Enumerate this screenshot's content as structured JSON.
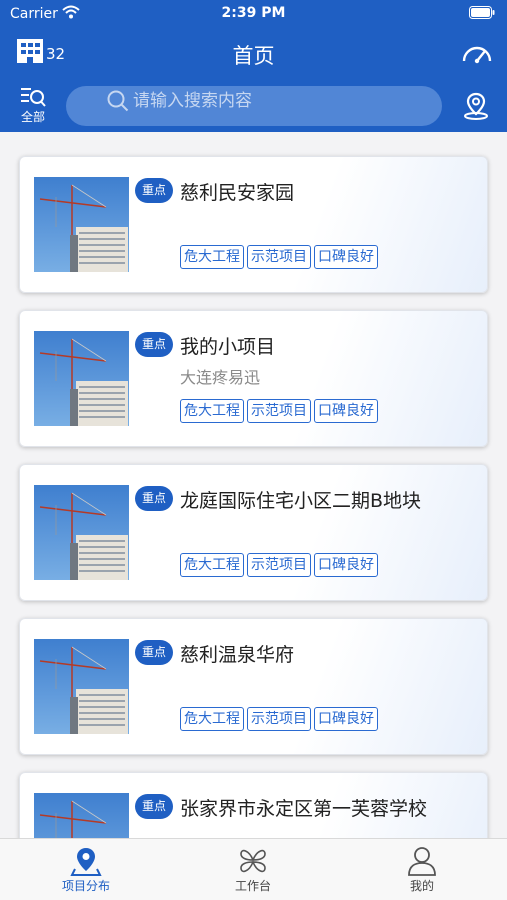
{
  "status_bar": {
    "carrier": "Carrier",
    "time": "2:39 PM"
  },
  "nav": {
    "title": "首页",
    "building_count": "32"
  },
  "search": {
    "filter_label": "全部",
    "placeholder": "请输入搜索内容"
  },
  "projects": [
    {
      "badge": "重点",
      "title": "慈利民安家园",
      "subtitle": "",
      "tags": [
        "危大工程",
        "示范项目",
        "口碑良好"
      ]
    },
    {
      "badge": "重点",
      "title": "我的小项目",
      "subtitle": "大连疼易迅",
      "tags": [
        "危大工程",
        "示范项目",
        "口碑良好"
      ]
    },
    {
      "badge": "重点",
      "title": "龙庭国际住宅小区二期B地块",
      "subtitle": "",
      "tags": [
        "危大工程",
        "示范项目",
        "口碑良好"
      ]
    },
    {
      "badge": "重点",
      "title": "慈利温泉华府",
      "subtitle": "",
      "tags": [
        "危大工程",
        "示范项目",
        "口碑良好"
      ]
    },
    {
      "badge": "重点",
      "title": "张家界市永定区第一芙蓉学校",
      "subtitle": "",
      "tags": []
    }
  ],
  "tabbar": [
    {
      "label": "项目分布",
      "icon": "location-pin-icon",
      "active": true
    },
    {
      "label": "工作台",
      "icon": "workbench-icon",
      "active": false
    },
    {
      "label": "我的",
      "icon": "person-icon",
      "active": false
    }
  ],
  "colors": {
    "primary": "#1f5fc3",
    "tag": "#2a6ad1",
    "background": "#f3f3f5"
  }
}
